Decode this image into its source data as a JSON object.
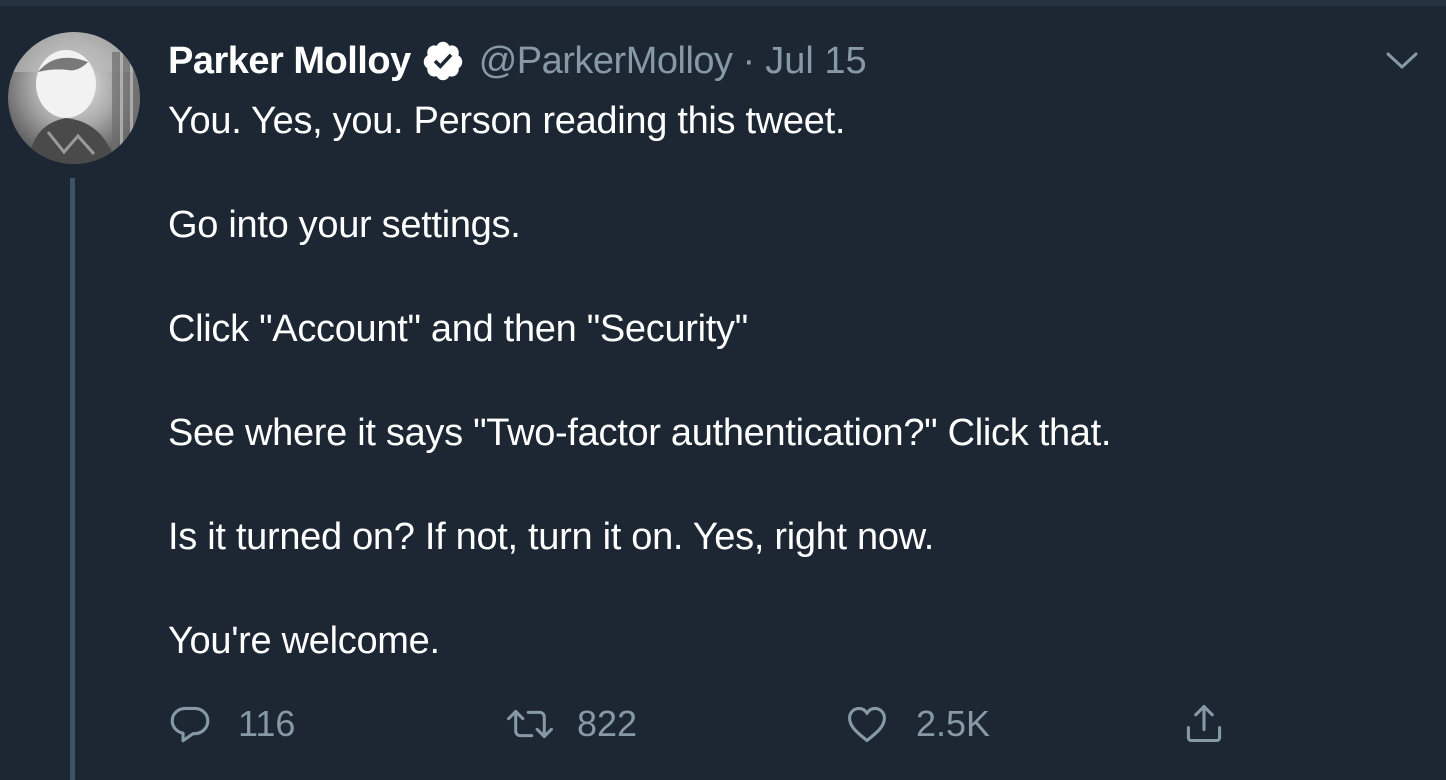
{
  "tweet": {
    "author": {
      "display_name": "Parker Molloy",
      "handle": "@ParkerMolloy",
      "verified": true
    },
    "separator": "·",
    "date": "Jul 15",
    "lines": [
      "You. Yes, you. Person reading this tweet.",
      "Go into your settings.",
      "Click \"Account\" and then \"Security\"",
      "See where it says \"Two-factor authentication?\" Click that.",
      "Is it turned on? If not, turn it on. Yes, right now.",
      "You're welcome."
    ],
    "actions": {
      "reply_count": "116",
      "retweet_count": "822",
      "like_count": "2.5K"
    }
  },
  "icons": {
    "verified": "verified-badge-icon",
    "caret": "chevron-down-icon",
    "reply": "reply-icon",
    "retweet": "retweet-icon",
    "like": "heart-icon",
    "share": "share-icon"
  },
  "colors": {
    "background": "#1c2733",
    "primary_text": "#ffffff",
    "secondary_text": "#8899a6",
    "thread_line": "#3d5466"
  }
}
